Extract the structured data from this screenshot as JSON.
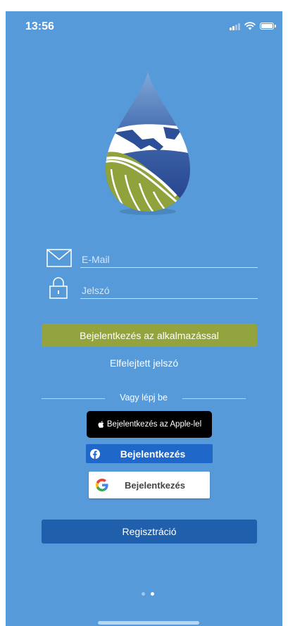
{
  "status_bar": {
    "time": "13:56"
  },
  "login_form": {
    "email": {
      "placeholder": "E-Mail",
      "value": ""
    },
    "password": {
      "placeholder": "Jelszó",
      "value": ""
    },
    "login_button_label": "Bejelentkezés az alkalmazással",
    "forgot_password_label": "Elfelejtett jelszó"
  },
  "social_login": {
    "divider_label": "Vagy lépj be",
    "apple_label": "Bejelentkezés az Apple-lel",
    "facebook_label": "Bejelentkezés",
    "google_label": "Bejelentkezés"
  },
  "register_button_label": "Regisztráció",
  "pager": {
    "current_page": 2,
    "total_pages": 2
  },
  "colors": {
    "background": "#569ada",
    "login_button": "#93a43f",
    "register_button": "#1f5fac",
    "facebook_button": "#1f67c8",
    "apple_button": "#000000"
  }
}
